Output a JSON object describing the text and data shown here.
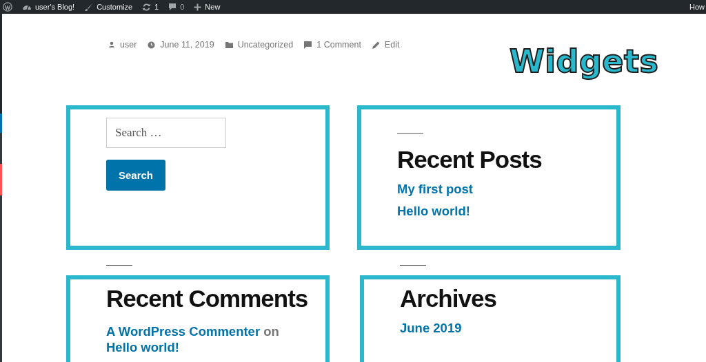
{
  "admin_bar": {
    "items": [
      {
        "kind": "logo"
      },
      {
        "kind": "site",
        "label": "user's Blog!"
      },
      {
        "kind": "customize",
        "label": "Customize"
      },
      {
        "kind": "updates",
        "label": "1"
      },
      {
        "kind": "comments",
        "label": "0"
      },
      {
        "kind": "new",
        "label": "New"
      }
    ],
    "right_label": "How"
  },
  "post_meta": [
    {
      "kind": "author",
      "label": "user"
    },
    {
      "kind": "date",
      "label": "June 11, 2019"
    },
    {
      "kind": "category",
      "label": "Uncategorized"
    },
    {
      "kind": "comments",
      "label": "1 Comment"
    },
    {
      "kind": "edit",
      "label": "Edit"
    }
  ],
  "annotation": "Widgets",
  "widgets": [
    {
      "kind": "search",
      "placeholder": "Search …",
      "button": "Search"
    },
    {
      "kind": "list",
      "title": "Recent Posts",
      "links": [
        "My first post",
        "Hello world!"
      ]
    },
    {
      "kind": "comments",
      "title": "Recent Comments",
      "author": "A WordPress Commenter",
      "connector": "on",
      "post": "Hello world!"
    },
    {
      "kind": "list",
      "title": "Archives",
      "links": [
        "June 2019"
      ]
    }
  ]
}
